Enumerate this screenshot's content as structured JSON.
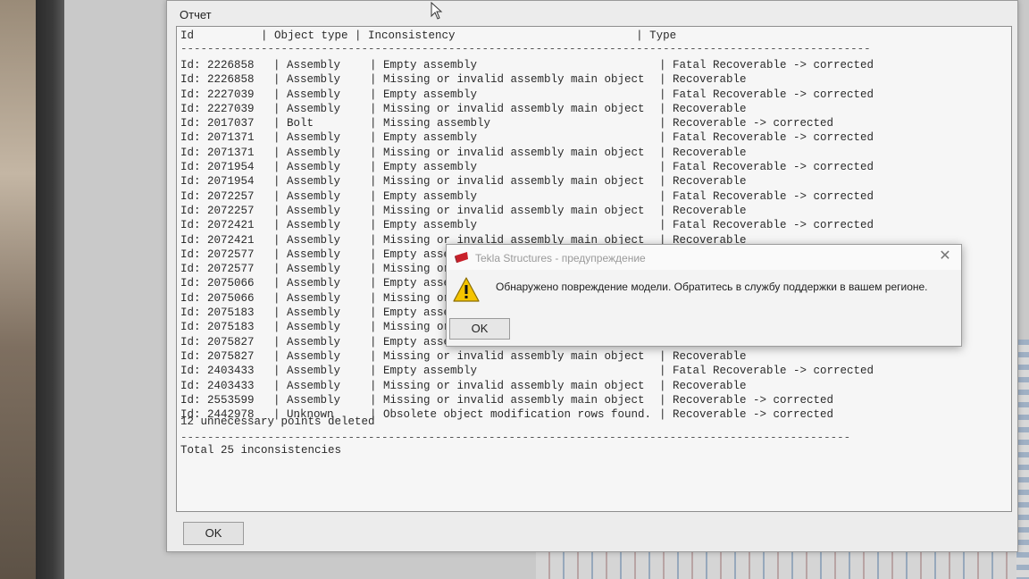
{
  "report": {
    "title": "Отчет",
    "header": "Id          | Object type | Inconsistency                           | Type",
    "separator": "--------------------------------------------------------------------------------------------------------------------------------------------",
    "rows": [
      {
        "id": "Id: 2226858",
        "object_type": "| Assembly",
        "inconsistency": "| Empty assembly",
        "type": "| Fatal Recoverable -> corrected"
      },
      {
        "id": "Id: 2226858",
        "object_type": "| Assembly",
        "inconsistency": "| Missing or invalid assembly main object",
        "type": "| Recoverable"
      },
      {
        "id": "Id: 2227039",
        "object_type": "| Assembly",
        "inconsistency": "| Empty assembly",
        "type": "| Fatal Recoverable -> corrected"
      },
      {
        "id": "Id: 2227039",
        "object_type": "| Assembly",
        "inconsistency": "| Missing or invalid assembly main object",
        "type": "| Recoverable"
      },
      {
        "id": "Id: 2017037",
        "object_type": "| Bolt",
        "inconsistency": "| Missing assembly",
        "type": "| Recoverable -> corrected"
      },
      {
        "id": "Id: 2071371",
        "object_type": "| Assembly",
        "inconsistency": "| Empty assembly",
        "type": "| Fatal Recoverable -> corrected"
      },
      {
        "id": "Id: 2071371",
        "object_type": "| Assembly",
        "inconsistency": "| Missing or invalid assembly main object",
        "type": "| Recoverable"
      },
      {
        "id": "Id: 2071954",
        "object_type": "| Assembly",
        "inconsistency": "| Empty assembly",
        "type": "| Fatal Recoverable -> corrected"
      },
      {
        "id": "Id: 2071954",
        "object_type": "| Assembly",
        "inconsistency": "| Missing or invalid assembly main object",
        "type": "| Recoverable"
      },
      {
        "id": "Id: 2072257",
        "object_type": "| Assembly",
        "inconsistency": "| Empty assembly",
        "type": "| Fatal Recoverable -> corrected"
      },
      {
        "id": "Id: 2072257",
        "object_type": "| Assembly",
        "inconsistency": "| Missing or invalid assembly main object",
        "type": "| Recoverable"
      },
      {
        "id": "Id: 2072421",
        "object_type": "| Assembly",
        "inconsistency": "| Empty assembly",
        "type": "| Fatal Recoverable -> corrected"
      },
      {
        "id": "Id: 2072421",
        "object_type": "| Assembly",
        "inconsistency": "| Missing or invalid assembly main object",
        "type": "| Recoverable"
      },
      {
        "id": "Id: 2072577",
        "object_type": "| Assembly",
        "inconsistency": "| Empty assem",
        "type": ""
      },
      {
        "id": "Id: 2072577",
        "object_type": "| Assembly",
        "inconsistency": "| Missing or",
        "type": ""
      },
      {
        "id": "Id: 2075066",
        "object_type": "| Assembly",
        "inconsistency": "| Empty assem",
        "type": ""
      },
      {
        "id": "Id: 2075066",
        "object_type": "| Assembly",
        "inconsistency": "| Missing or",
        "type": ""
      },
      {
        "id": "Id: 2075183",
        "object_type": "| Assembly",
        "inconsistency": "| Empty assem",
        "type": ""
      },
      {
        "id": "Id: 2075183",
        "object_type": "| Assembly",
        "inconsistency": "| Missing or",
        "type": ""
      },
      {
        "id": "Id: 2075827",
        "object_type": "| Assembly",
        "inconsistency": "| Empty assem",
        "type": ""
      },
      {
        "id": "Id: 2075827",
        "object_type": "| Assembly",
        "inconsistency": "| Missing or invalid assembly main object",
        "type": "| Recoverable"
      },
      {
        "id": "Id: 2403433",
        "object_type": "| Assembly",
        "inconsistency": "| Empty assembly",
        "type": "| Fatal Recoverable -> corrected"
      },
      {
        "id": "Id: 2403433",
        "object_type": "| Assembly",
        "inconsistency": "| Missing or invalid assembly main object",
        "type": "| Recoverable"
      },
      {
        "id": "Id: 2553599",
        "object_type": "| Assembly",
        "inconsistency": "| Missing or invalid assembly main object",
        "type": "| Recoverable -> corrected"
      },
      {
        "id": "Id: 2442978",
        "object_type": "| Unknown",
        "inconsistency": "| Obsolete object modification rows found.",
        "type": "| Recoverable -> corrected"
      }
    ],
    "points_note": "12 unnecessary points deleted",
    "total": "Total 25 inconsistencies",
    "ok_label": "OK"
  },
  "dialog": {
    "title": "Tekla Structures - предупреждение",
    "message": "Обнаружено повреждение модели. Обратитесь в службу поддержки в вашем регионе.",
    "ok_label": "OK",
    "close_glyph": "✕"
  },
  "colors": {
    "warning_yellow": "#f5c400",
    "app_icon_red": "#c8202a"
  }
}
